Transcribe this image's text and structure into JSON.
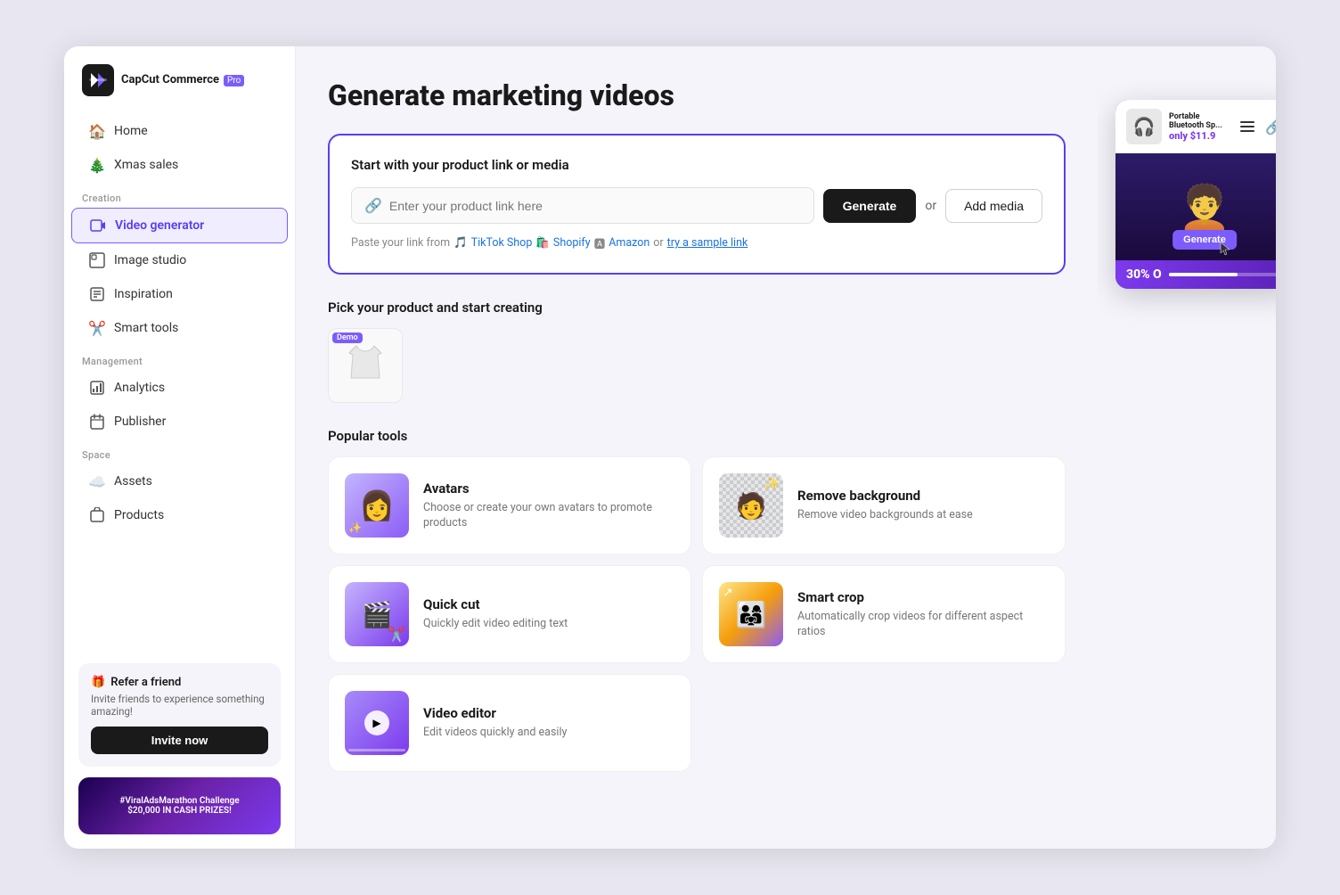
{
  "app": {
    "title": "CapCut Commerce",
    "pro_badge": "Pro"
  },
  "sidebar": {
    "nav": [
      {
        "id": "home",
        "label": "Home",
        "icon": "🏠"
      },
      {
        "id": "xmas",
        "label": "Xmas sales",
        "icon": "🎄"
      }
    ],
    "creation_label": "Creation",
    "creation_items": [
      {
        "id": "video-generator",
        "label": "Video generator",
        "icon": "📹",
        "active": true
      },
      {
        "id": "image-studio",
        "label": "Image studio",
        "icon": "🖼️"
      },
      {
        "id": "inspiration",
        "label": "Inspiration",
        "icon": "💡"
      },
      {
        "id": "smart-tools",
        "label": "Smart tools",
        "icon": "✂️"
      }
    ],
    "management_label": "Management",
    "management_items": [
      {
        "id": "analytics",
        "label": "Analytics",
        "icon": "📊"
      },
      {
        "id": "publisher",
        "label": "Publisher",
        "icon": "📅"
      }
    ],
    "space_label": "Space",
    "space_items": [
      {
        "id": "assets",
        "label": "Assets",
        "icon": "☁️"
      },
      {
        "id": "products",
        "label": "Products",
        "icon": "📦"
      }
    ],
    "refer": {
      "icon": "🎁",
      "title": "Refer a friend",
      "description": "Invite friends to experience something amazing!",
      "button_label": "Invite now"
    },
    "promo": {
      "hashtag": "#ViralAdsMarathon Challenge",
      "prize": "$20,000 IN CASH PRIZES!"
    }
  },
  "main": {
    "page_title": "Generate marketing videos",
    "product_link_section": {
      "subtitle": "Start with your product link or media",
      "input_placeholder": "Enter your product link here",
      "generate_button": "Generate",
      "or_text": "or",
      "add_media_button": "Add media",
      "paste_hint": "Paste your link from",
      "platforms": [
        {
          "id": "tiktokshop",
          "label": "TikTok Shop",
          "icon": "🎵"
        },
        {
          "id": "shopify",
          "label": "Shopify",
          "icon": "🛍️"
        },
        {
          "id": "amazon",
          "label": "Amazon",
          "icon": "🅰"
        }
      ],
      "try_sample": "try a sample link"
    },
    "pick_product_section": {
      "title": "Pick your product and start creating",
      "products": [
        {
          "id": "shirt",
          "demo": true,
          "name": "White Shirt"
        }
      ]
    },
    "popular_tools_section": {
      "title": "Popular tools",
      "tools": [
        {
          "id": "avatars",
          "name": "Avatars",
          "description": "Choose or create your own avatars to promote products",
          "thumb_type": "avatars"
        },
        {
          "id": "remove-background",
          "name": "Remove background",
          "description": "Remove video backgrounds at ease",
          "thumb_type": "remove-bg"
        },
        {
          "id": "quick-cut",
          "name": "Quick cut",
          "description": "Quickly edit video editing text",
          "thumb_type": "quickcut"
        },
        {
          "id": "smart-crop",
          "name": "Smart crop",
          "description": "Automatically crop videos for different aspect ratios",
          "thumb_type": "crop"
        },
        {
          "id": "video-editor",
          "name": "Video editor",
          "description": "Edit videos quickly and easily",
          "thumb_type": "editor"
        }
      ]
    }
  },
  "preview": {
    "product_name": "Portable Bluetooth Sp...",
    "product_price": "only $11.9",
    "sale_text": "30% O",
    "generate_button": "Generate"
  }
}
